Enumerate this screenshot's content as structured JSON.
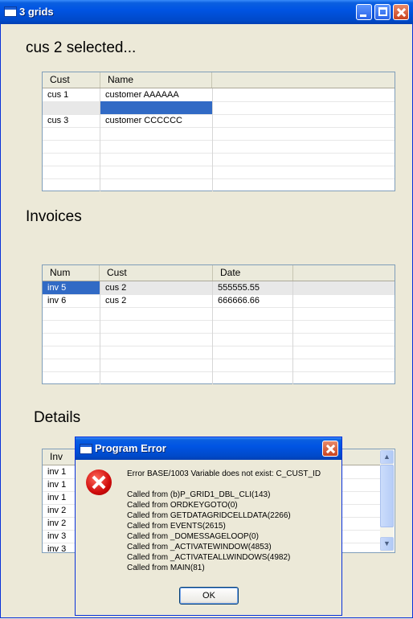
{
  "window": {
    "title": "3 grids"
  },
  "labels": {
    "customers": "cus 2  selected...",
    "invoices": "Invoices",
    "details": "Details"
  },
  "grid_customers": {
    "columns": [
      "Cust",
      "Name"
    ],
    "rows": [
      [
        "cus 1",
        "customer AAAAAA"
      ],
      [
        "",
        ""
      ],
      [
        "cus 3",
        "customer CCCCCC"
      ]
    ]
  },
  "grid_invoices": {
    "columns": [
      "Num",
      "Cust",
      "Date"
    ],
    "rows": [
      [
        "inv 5",
        "cus 2",
        "555555.55"
      ],
      [
        "inv 6",
        "cus 2",
        "666666.66"
      ]
    ]
  },
  "grid_details": {
    "columns": [
      "Inv"
    ],
    "rows": [
      [
        "inv 1"
      ],
      [
        "inv 1"
      ],
      [
        "inv 1"
      ],
      [
        "inv 2"
      ],
      [
        "inv 2"
      ],
      [
        "inv 3"
      ],
      [
        "inv 3"
      ]
    ]
  },
  "dialog": {
    "title": "Program Error",
    "error": "Error BASE/1003  Variable does not exist: C_CUST_ID",
    "stack": [
      "Called from (b)P_GRID1_DBL_CLI(143)",
      "Called from ORDKEYGOTO(0)",
      "Called from GETDATAGRIDCELLDATA(2266)",
      "Called from EVENTS(2615)",
      "Called from _DOMESSAGELOOP(0)",
      "Called from _ACTIVATEWINDOW(4853)",
      "Called from _ACTIVATEALLWINDOWS(4982)",
      "Called from MAIN(81)"
    ],
    "ok_label": "OK"
  },
  "colors": {
    "selection": "#316ac5",
    "titlebar": "#0054e3",
    "error_red": "#d00c0c"
  }
}
